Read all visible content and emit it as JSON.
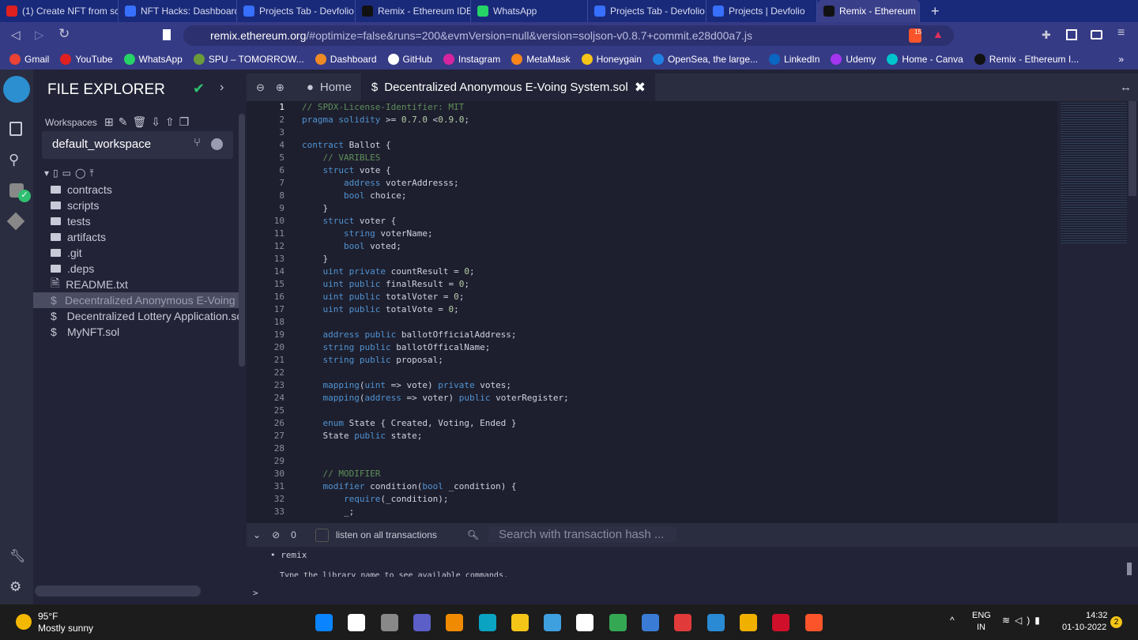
{
  "browser": {
    "tabs": [
      {
        "label": "(1) Create NFT from sc",
        "color": "#e02020"
      },
      {
        "label": "NFT Hacks: Dashboard",
        "color": "#3770ff"
      },
      {
        "label": "Projects Tab - Devfolio",
        "color": "#3770ff"
      },
      {
        "label": "Remix - Ethereum IDE",
        "color": "#111"
      },
      {
        "label": "WhatsApp",
        "color": "#25d366"
      },
      {
        "label": "Projects Tab - Devfolio",
        "color": "#3770ff"
      },
      {
        "label": "Projects | Devfolio",
        "color": "#3770ff"
      },
      {
        "label": "Remix - Ethereum",
        "color": "#111",
        "active": true
      }
    ],
    "url_host": "remix.ethereum.org",
    "url_rest": "/#optimize=false&runs=200&evmVersion=null&version=soljson-v0.8.7+commit.e28d00a7.js",
    "brave_badge": "15",
    "bookmarks": [
      {
        "label": "Gmail",
        "color": "#ea4335"
      },
      {
        "label": "YouTube",
        "color": "#e02020"
      },
      {
        "label": "WhatsApp",
        "color": "#25d366"
      },
      {
        "label": "SPU – TOMORROW...",
        "color": "#6a9a3a"
      },
      {
        "label": "Dashboard",
        "color": "#f08a24"
      },
      {
        "label": "GitHub",
        "color": "#fff"
      },
      {
        "label": "Instagram",
        "color": "#d6249f"
      },
      {
        "label": "MetaMask",
        "color": "#f6851b"
      },
      {
        "label": "Honeygain",
        "color": "#f5c518"
      },
      {
        "label": "OpenSea, the large...",
        "color": "#2081e2"
      },
      {
        "label": "LinkedIn",
        "color": "#0a66c2"
      },
      {
        "label": "Udemy",
        "color": "#a435f0"
      },
      {
        "label": "Home - Canva",
        "color": "#00c4cc"
      },
      {
        "label": "Remix - Ethereum I...",
        "color": "#111"
      }
    ],
    "more": "»"
  },
  "sidebar": {
    "title": "FILE EXPLORER",
    "workspaces_label": "Workspaces",
    "workspace": "default_workspace",
    "items": [
      {
        "label": "contracts",
        "type": "folder"
      },
      {
        "label": "scripts",
        "type": "folder"
      },
      {
        "label": "tests",
        "type": "folder"
      },
      {
        "label": "artifacts",
        "type": "folder"
      },
      {
        "label": ".git",
        "type": "folder"
      },
      {
        "label": ".deps",
        "type": "folder"
      },
      {
        "label": "README.txt",
        "type": "file"
      },
      {
        "label": "Decentralized Anonymous E-Voing System.sol",
        "type": "sol",
        "selected": true
      },
      {
        "label": "Decentralized Lottery Application.sol",
        "type": "sol"
      },
      {
        "label": "MyNFT.sol",
        "type": "sol"
      }
    ]
  },
  "editor": {
    "home_tab": "Home",
    "file_tab": "Decentralized Anonymous E-Voing System.sol",
    "lines": [
      [
        [
          "c",
          "// SPDX-License-Identifier: MIT"
        ]
      ],
      [
        [
          "k",
          "pragma solidity"
        ],
        [
          "p",
          " >= "
        ],
        [
          "n",
          "0.7.0"
        ],
        [
          "p",
          " <"
        ],
        [
          "n",
          "0.9.0"
        ],
        [
          "p",
          ";"
        ]
      ],
      [],
      [
        [
          "k",
          "contract"
        ],
        [
          "p",
          " Ballot {"
        ]
      ],
      [
        [
          "p",
          "    "
        ],
        [
          "c",
          "// VARIBLES"
        ]
      ],
      [
        [
          "p",
          "    "
        ],
        [
          "k",
          "struct"
        ],
        [
          "p",
          " vote {"
        ]
      ],
      [
        [
          "p",
          "        "
        ],
        [
          "k",
          "address"
        ],
        [
          "p",
          " voterAddresss;"
        ]
      ],
      [
        [
          "p",
          "        "
        ],
        [
          "k",
          "bool"
        ],
        [
          "p",
          " choice;"
        ]
      ],
      [
        [
          "p",
          "    }"
        ]
      ],
      [
        [
          "p",
          "    "
        ],
        [
          "k",
          "struct"
        ],
        [
          "p",
          " voter {"
        ]
      ],
      [
        [
          "p",
          "        "
        ],
        [
          "k",
          "string"
        ],
        [
          "p",
          " voterName;"
        ]
      ],
      [
        [
          "p",
          "        "
        ],
        [
          "k",
          "bool"
        ],
        [
          "p",
          " voted;"
        ]
      ],
      [
        [
          "p",
          "    }"
        ]
      ],
      [
        [
          "p",
          "    "
        ],
        [
          "k",
          "uint private"
        ],
        [
          "p",
          " countResult = "
        ],
        [
          "n",
          "0"
        ],
        [
          "p",
          ";"
        ]
      ],
      [
        [
          "p",
          "    "
        ],
        [
          "k",
          "uint public"
        ],
        [
          "p",
          " finalResult = "
        ],
        [
          "n",
          "0"
        ],
        [
          "p",
          ";"
        ]
      ],
      [
        [
          "p",
          "    "
        ],
        [
          "k",
          "uint public"
        ],
        [
          "p",
          " totalVoter = "
        ],
        [
          "n",
          "0"
        ],
        [
          "p",
          ";"
        ]
      ],
      [
        [
          "p",
          "    "
        ],
        [
          "k",
          "uint public"
        ],
        [
          "p",
          " totalVote = "
        ],
        [
          "n",
          "0"
        ],
        [
          "p",
          ";"
        ]
      ],
      [],
      [
        [
          "p",
          "    "
        ],
        [
          "k",
          "address public"
        ],
        [
          "p",
          " ballotOfficialAddress;"
        ]
      ],
      [
        [
          "p",
          "    "
        ],
        [
          "k",
          "string public"
        ],
        [
          "p",
          " ballotOfficalName;"
        ]
      ],
      [
        [
          "p",
          "    "
        ],
        [
          "k",
          "string public"
        ],
        [
          "p",
          " proposal;"
        ]
      ],
      [],
      [
        [
          "p",
          "    "
        ],
        [
          "k",
          "mapping"
        ],
        [
          "p",
          "("
        ],
        [
          "k",
          "uint"
        ],
        [
          "p",
          " => vote) "
        ],
        [
          "k",
          "private"
        ],
        [
          "p",
          " votes;"
        ]
      ],
      [
        [
          "p",
          "    "
        ],
        [
          "k",
          "mapping"
        ],
        [
          "p",
          "("
        ],
        [
          "k",
          "address"
        ],
        [
          "p",
          " => voter) "
        ],
        [
          "k",
          "public"
        ],
        [
          "p",
          " voterRegister;"
        ]
      ],
      [],
      [
        [
          "p",
          "    "
        ],
        [
          "k",
          "enum"
        ],
        [
          "p",
          " State { Created, Voting, Ended }"
        ]
      ],
      [
        [
          "p",
          "    State "
        ],
        [
          "k",
          "public"
        ],
        [
          "p",
          " state;"
        ]
      ],
      [],
      [],
      [
        [
          "p",
          "    "
        ],
        [
          "c",
          "// MODIFIER"
        ]
      ],
      [
        [
          "p",
          "    "
        ],
        [
          "k",
          "modifier"
        ],
        [
          "p",
          " condition("
        ],
        [
          "k",
          "bool"
        ],
        [
          "p",
          " _condition) {"
        ]
      ],
      [
        [
          "p",
          "        "
        ],
        [
          "k",
          "require"
        ],
        [
          "p",
          "(_condition);"
        ]
      ],
      [
        [
          "p",
          "        _;"
        ]
      ]
    ]
  },
  "terminal": {
    "count": "0",
    "listen_label": "listen on all transactions",
    "search_placeholder": "Search with transaction hash ...",
    "output_item": "remix",
    "output_hint": "Type the library name to see available commands.",
    "prompt": ">"
  },
  "taskbar": {
    "temp": "95°F",
    "weather": "Mostly sunny",
    "lang1": "ENG",
    "lang2": "IN",
    "time": "14:32",
    "date": "01-10-2022",
    "notif": "2",
    "apps": [
      "#0a84ff",
      "#fff",
      "#888",
      "#5b5fc7",
      "#f08a00",
      "#0aa3c2",
      "#f5c518",
      "#3fa0e0",
      "#fff",
      "#34a853",
      "#3a7bd5",
      "#e03a3a",
      "#2a8ad4",
      "#f0b000",
      "#d0102a",
      "#fb542b"
    ]
  }
}
